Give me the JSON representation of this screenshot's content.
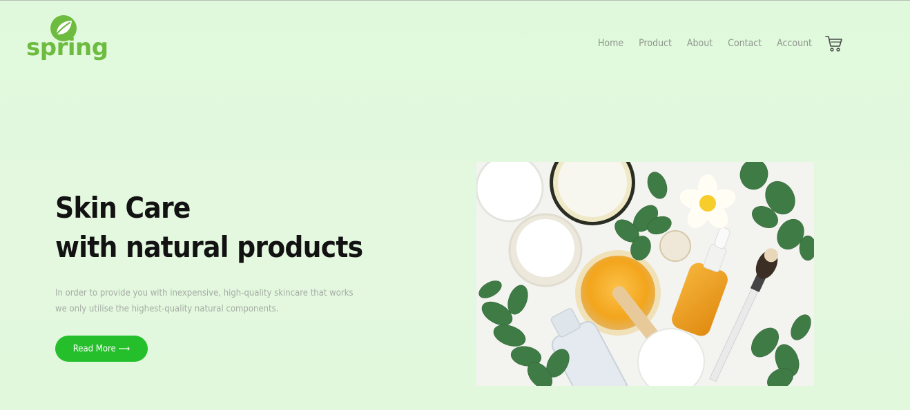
{
  "brand": {
    "name": "spring",
    "color": "#6dbb3f",
    "icon": "leaf-icon"
  },
  "nav": {
    "items": [
      "Home",
      "Product",
      "About",
      "Contact",
      "Account"
    ],
    "cart_icon": "cart-icon"
  },
  "hero": {
    "title_line1": "Skin Care",
    "title_line2": "with natural products",
    "description_line1": "In order to provide you with inexpensive, high-quality skincare that works",
    "description_line2": "we only utilise the highest-quality natural components.",
    "button_label": "Read More ⟶",
    "button_color": "#25bf2c"
  },
  "colors": {
    "background": "#e2f8de",
    "nav_text": "#8e968c",
    "title": "#121212",
    "body_text": "#a5aca3"
  }
}
